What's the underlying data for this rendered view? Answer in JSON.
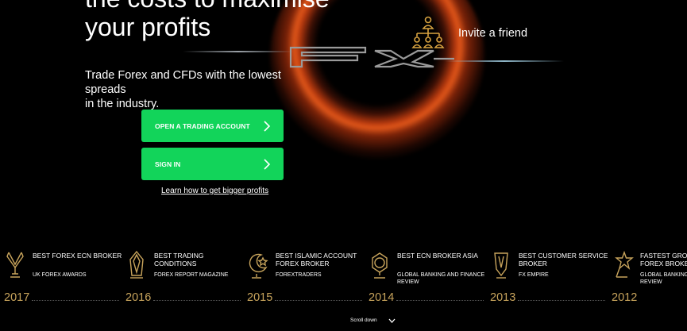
{
  "hero": {
    "title_line1": "the costs to maximise",
    "title_line2": "your profits",
    "subtitle_line1": "Trade Forex and CFDs with the lowest spreads",
    "subtitle_line2": "in the industry."
  },
  "invite": {
    "label": "Invite a friend",
    "icon": "referral-network-icon"
  },
  "buttons": {
    "open_account": "OPEN A TRADING ACCOUNT",
    "sign_in": "SIGN IN"
  },
  "learn_link": "Learn how to get bigger profits",
  "awards": [
    {
      "title": "BEST FOREX ECN BROKER",
      "source": "UK FOREX AWARDS",
      "year": "2017",
      "icon": "award-trophy-icon"
    },
    {
      "title": "BEST TRADING CONDITIONS",
      "source": "FOREX REPORT MAGAZINE",
      "year": "2016",
      "icon": "award-crystal-icon"
    },
    {
      "title": "BEST ISLAMIC ACCOUNT\nFOREX BROKER",
      "source": "FOREXTRADERS",
      "year": "2015",
      "icon": "crescent-star-icon"
    },
    {
      "title": "BEST ECN BROKER ASIA",
      "source": "GLOBAL BANKING AND FINANCE\nREVIEW",
      "year": "2014",
      "icon": "award-globe-icon"
    },
    {
      "title": "BEST CUSTOMER SERVICE\nBROKER",
      "source": "FX EMPIRE",
      "year": "2013",
      "icon": "award-shield-icon"
    },
    {
      "title": "FASTEST GROW\nFOREX BROKER",
      "source": "GLOBAL BANKING\nREVIEW",
      "year": "2012",
      "icon": "award-star-icon"
    }
  ],
  "scroll": {
    "label": "Scroll down"
  },
  "colors": {
    "accent_green": "#12d45a",
    "year_gold": "#c8a45c",
    "background": "#000000"
  }
}
